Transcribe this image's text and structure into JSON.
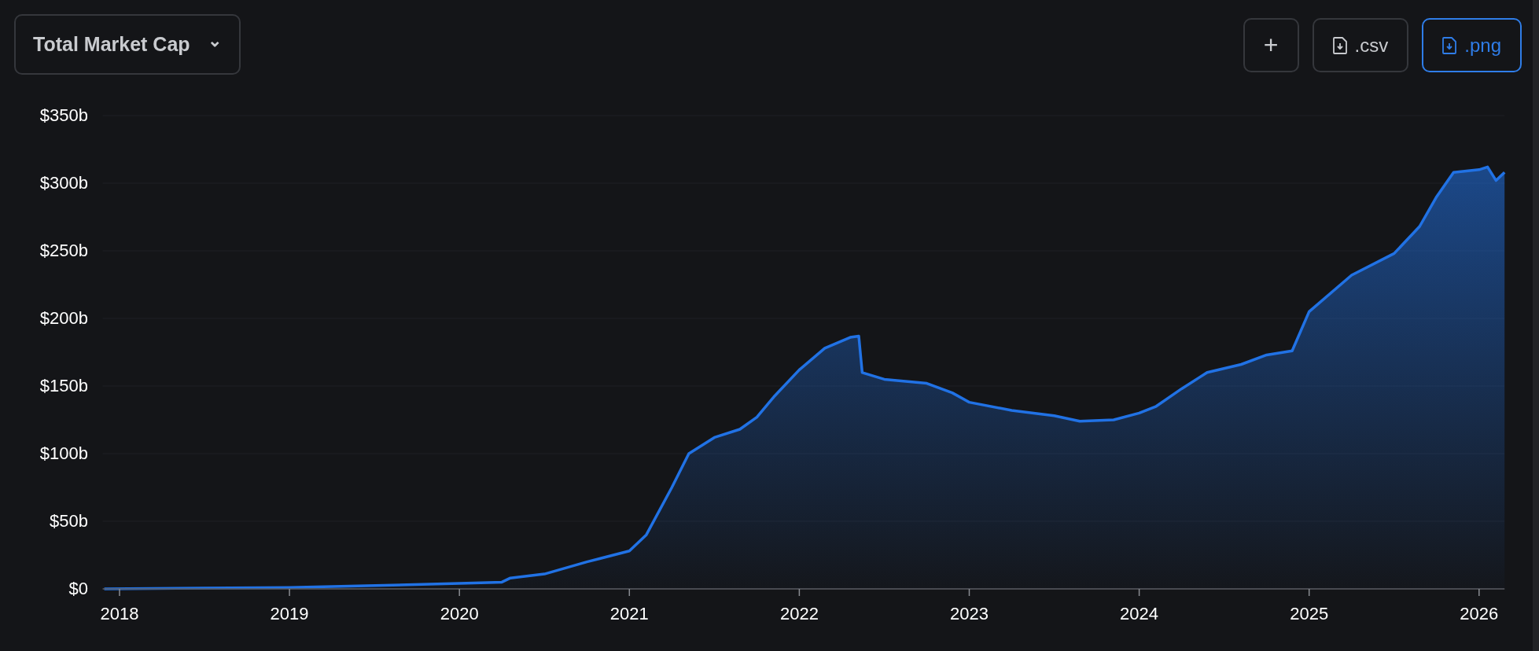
{
  "metric_selector": {
    "label": "Total Market Cap",
    "caret": "⌄"
  },
  "actions": [
    {
      "kind": "add",
      "label": "+",
      "selected": false
    },
    {
      "kind": "file",
      "label": ".csv",
      "selected": false
    },
    {
      "kind": "file",
      "label": ".png",
      "selected": true
    }
  ],
  "chart": {
    "chart_data": {
      "type": "area",
      "xticks": [
        2018,
        2019,
        2020,
        2021,
        2022,
        2023,
        2024,
        2025,
        2026
      ],
      "yticks": [
        {
          "value": 0,
          "label": "$0"
        },
        {
          "value": 50,
          "label": "$50b"
        },
        {
          "value": 100,
          "label": "$100b"
        },
        {
          "value": 150,
          "label": "$150b"
        },
        {
          "value": 200,
          "label": "$200b"
        },
        {
          "value": 250,
          "label": "$250b"
        },
        {
          "value": 300,
          "label": "$300b"
        },
        {
          "value": 350,
          "label": "$350b"
        }
      ],
      "ylim": [
        0,
        350
      ],
      "xlim": [
        2017.91,
        2026.15
      ],
      "x": [
        2017.91,
        2019.0,
        2020.0,
        2020.25,
        2020.3,
        2020.5,
        2020.75,
        2021.0,
        2021.1,
        2021.25,
        2021.35,
        2021.5,
        2021.65,
        2021.75,
        2021.85,
        2022.0,
        2022.15,
        2022.3,
        2022.35,
        2022.37,
        2022.5,
        2022.75,
        2022.9,
        2023.0,
        2023.25,
        2023.5,
        2023.65,
        2023.85,
        2024.0,
        2024.1,
        2024.25,
        2024.4,
        2024.6,
        2024.75,
        2024.9,
        2025.0,
        2025.25,
        2025.5,
        2025.65,
        2025.75,
        2025.85,
        2026.0,
        2026.05,
        2026.1,
        2026.15
      ],
      "grid": true,
      "series": [
        {
          "color": "#2172e5",
          "values": [
            0,
            1,
            4,
            5,
            8,
            11,
            20,
            28,
            40,
            75,
            100,
            112,
            118,
            127,
            142,
            162,
            178,
            186,
            187,
            160,
            155,
            152,
            145,
            138,
            132,
            128,
            124,
            125,
            130,
            135,
            148,
            160,
            166,
            173,
            176,
            205,
            232,
            248,
            268,
            290,
            308,
            310,
            312,
            302,
            308
          ]
        }
      ]
    }
  }
}
